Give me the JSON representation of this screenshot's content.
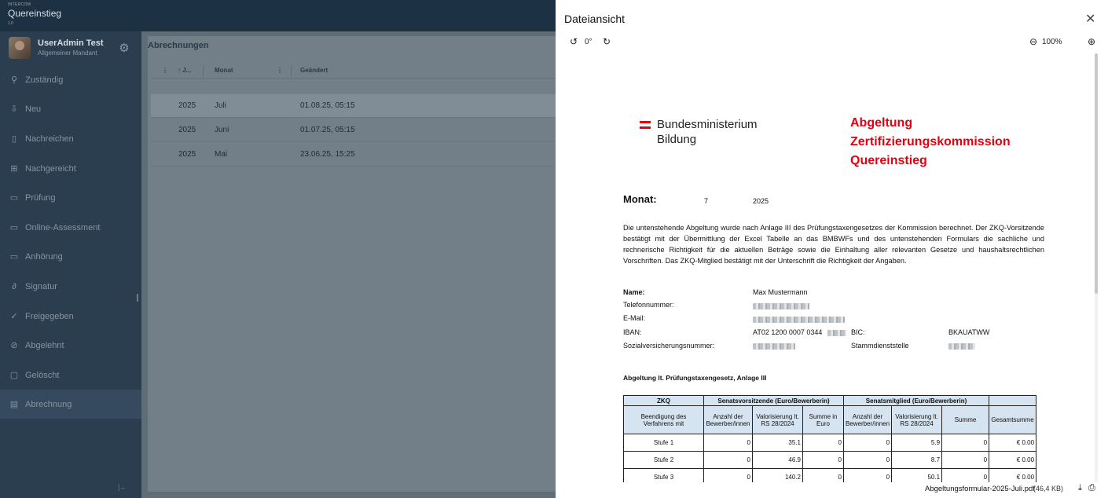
{
  "app": {
    "brand_small": "INTERCOM",
    "title": "Quereinstieg",
    "version": "1.0"
  },
  "user": {
    "name": "UserAdmin Test",
    "tenant": "Allgemeiner Mandant"
  },
  "sidebar": {
    "items": [
      {
        "label": "Zuständig",
        "icon": "person-icon"
      },
      {
        "label": "Neu",
        "icon": "inbox-download-icon"
      },
      {
        "label": "Nachreichen",
        "icon": "document-icon"
      },
      {
        "label": "Nachgereicht",
        "icon": "document-plus-icon"
      },
      {
        "label": "Prüfung",
        "icon": "folder-icon"
      },
      {
        "label": "Online-Assessment",
        "icon": "folder-icon"
      },
      {
        "label": "Anhörung",
        "icon": "folder-icon"
      },
      {
        "label": "Signatur",
        "icon": "signature-icon"
      },
      {
        "label": "Freigegeben",
        "icon": "check-icon"
      },
      {
        "label": "Abgelehnt",
        "icon": "blocked-icon"
      },
      {
        "label": "Gelöscht",
        "icon": "trash-icon"
      },
      {
        "label": "Abrechnung",
        "icon": "invoice-icon"
      }
    ],
    "active_index": 11
  },
  "grid": {
    "title": "Abrechnungen",
    "columns": [
      "↑ J...",
      "Monat",
      "Geändert"
    ],
    "rows": [
      {
        "year": "2025",
        "month": "Juli",
        "changed": "01.08.25, 05:15"
      },
      {
        "year": "2025",
        "month": "Juni",
        "changed": "01.07.25, 05:15"
      },
      {
        "year": "2025",
        "month": "Mai",
        "changed": "23.06.25, 15:25"
      }
    ]
  },
  "viewer": {
    "title": "Dateiansicht",
    "rotation": "0°",
    "zoom": "100%",
    "file_name": "Abgeltungsformular-2025-Juli.pdf",
    "file_size": "(46,4 KB)"
  },
  "doc": {
    "logo_line1": "Bundesministerium",
    "logo_line2": "Bildung",
    "heading_lines": [
      "Abgeltung",
      "Zertifizierungskommission",
      "Quereinstieg"
    ],
    "monat_label": "Monat:",
    "monat_value": "7",
    "year_value": "2025",
    "paragraph": "Die untenstehende Abgeltung wurde nach Anlage III des Prüfungstaxengesetzes der Kommission berechnet. Der ZKQ-Vorsitzende bestätigt mit der Übermittlung der Excel Tabelle an das BMBWFs und des untenstehenden Formulars die sachliche und rechnerische Richtigkeit für die aktuellen Beträge sowie die Einhaltung aller relevanten Gesetze und haushaltsrechtlichen Vorschriften. Das ZKQ-Mitglied bestätigt mit der Unterschrift die Richtigkeit der Angaben.",
    "fields": {
      "name_label": "Name:",
      "name_value": "Max Mustermann",
      "phone_label": "Telefonnummer:",
      "email_label": "E-Mail:",
      "iban_label": "IBAN:",
      "iban_value": "AT02 1200 0007 0344",
      "bic_label": "BIC:",
      "bic_value": "BKAUATWW",
      "svnr_label": "Sozialversicherungsnummer:",
      "stamm_label": "Stammdienststelle"
    },
    "table_title": "Abgeltung lt. Prüfungstaxengesetz, Anlage III",
    "table": {
      "group_headers": [
        "ZKQ",
        "Senatsvorsitzende (Euro/Bewerberin)",
        "Senatsmitglied (Euro/Bewerberin)",
        ""
      ],
      "sub_headers": [
        "Beendigung des Verfahrens mit",
        "Anzahl der Bewerber/innen",
        "Valorisierung lt. RS 28/2024",
        "Summe in Euro",
        "Anzahl der Bewerber/innen",
        "Valorisierung lt. RS 28/2024",
        "Summe",
        "Gesamtsumme"
      ],
      "rows": [
        [
          "Stufe 1",
          "0",
          "35.1",
          "0",
          "0",
          "5.9",
          "0",
          "€ 0.00"
        ],
        [
          "Stufe 2",
          "0",
          "46.9",
          "0",
          "0",
          "8.7",
          "0",
          "€ 0.00"
        ],
        [
          "Stufe 3",
          "0",
          "140.2",
          "0",
          "0",
          "50.1",
          "0",
          "€ 0.00"
        ]
      ]
    }
  }
}
